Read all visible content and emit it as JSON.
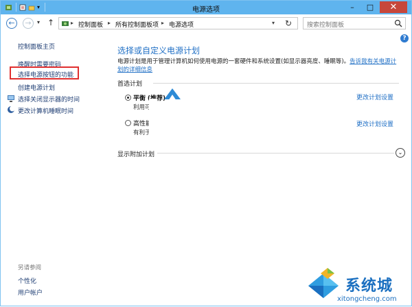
{
  "window": {
    "title": "电源选项",
    "controls": {
      "minimize": "–",
      "maximize": "□",
      "close": "✕"
    }
  },
  "navbar": {
    "back": "←",
    "forward": "→",
    "history": "▾",
    "up": "↑",
    "breadcrumb": [
      "控制面板",
      "所有控制面板项",
      "电源选项"
    ],
    "separator": "▸",
    "dropdown": "▾",
    "refresh": "↻",
    "search_placeholder": "搜索控制面板"
  },
  "help": "?",
  "sidebar": {
    "items": [
      {
        "label": "控制面板主页"
      },
      {
        "label": "唤醒时需要密码"
      },
      {
        "label": "选择电源按钮的功能",
        "highlighted": true
      },
      {
        "label": "创建电源计划"
      },
      {
        "label": "选择关闭显示器的时间",
        "icon": "monitor-icon"
      },
      {
        "label": "更改计算机睡眠时间",
        "icon": "moon-icon"
      }
    ],
    "see_also_label": "另请参阅",
    "see_also": [
      {
        "label": "个性化"
      },
      {
        "label": "用户帐户"
      }
    ]
  },
  "main": {
    "heading": "选择或自定义电源计划",
    "description": "电源计划是用于管理计算机如何使用电源的一套硬件和系统设置(如显示器亮度、睡眠等)。",
    "description_link": "告诉我有关电源计划的详细信息",
    "preferred_label": "首选计划",
    "plans": [
      {
        "name": "平衡",
        "tag": "(推荐)",
        "desc": "利用可",
        "selected": true,
        "link": "更改计划设置"
      },
      {
        "name": "高性能",
        "desc": "有利于",
        "selected": false,
        "link": "更改计划设置"
      }
    ],
    "additional_label": "显示附加计划",
    "expand": "⌄"
  },
  "watermark": {
    "title": "系统城",
    "url": "xitongcheng.com"
  },
  "colors": {
    "accent": "#1f6fc5",
    "titlebar": "#5fb4ee",
    "close": "#c7473b",
    "highlight": "#e02e2e"
  }
}
